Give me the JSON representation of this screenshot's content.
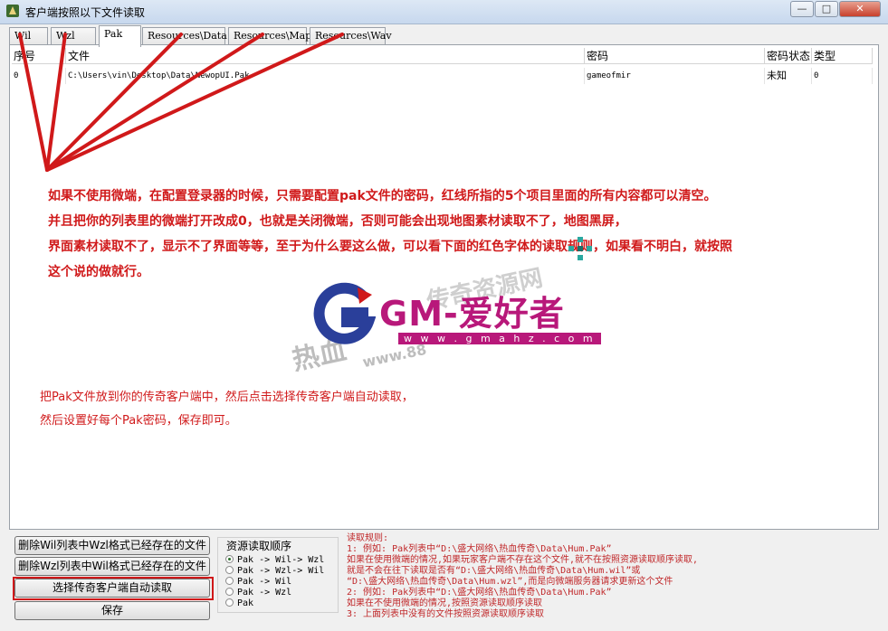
{
  "window": {
    "title": "客户端按照以下文件读取",
    "controls": {
      "minimize": "—",
      "maximize": "□",
      "close": "✕"
    }
  },
  "tabs": [
    {
      "label": "Wil"
    },
    {
      "label": "Wzl"
    },
    {
      "label": "Pak"
    },
    {
      "label": "Resources\\Data"
    },
    {
      "label": "Resources\\Map"
    },
    {
      "label": "Resources\\Wav"
    }
  ],
  "grid": {
    "columns": [
      "序号",
      "文件",
      "密码",
      "密码状态",
      "类型"
    ],
    "rows": [
      [
        "0",
        "C:\\Users\\vin\\Desktop\\Data\\NewopUI.Pak",
        "gameofmir",
        "未知",
        "0"
      ]
    ]
  },
  "notes": {
    "line1": "如果不使用微端，在配置登录器的时候，只需要配置pak文件的密码，红线所指的5个项目里面的所有内容都可以清空。",
    "line2": "并且把你的列表里的微端打开改成0，也就是关闭微端，否则可能会出现地图素材读取不了，地图黑屏，",
    "line3": "界面素材读取不了，显示不了界面等等，至于为什么要这么做，可以看下面的红色字体的读取规则，如果看不明白，就按照",
    "line4": "这个说的做就行。",
    "hint1": "把Pak文件放到你的传奇客户端中，然后点击选择传奇客户端自动读取，",
    "hint2": "然后设置好每个Pak密码，保存即可。"
  },
  "logo": {
    "letter": "G",
    "text": "GM-爱好者",
    "url": "w w w . g m a h z . c o m"
  },
  "watermark": {
    "text1": "热血",
    "text2": "传奇资源网",
    "text3": "www.88"
  },
  "buttons": {
    "delete_wil": "删除Wil列表中Wzl格式已经存在的文件",
    "delete_wzl": "删除Wzl列表中Wil格式已经存在的文件",
    "auto_read": "选择传奇客户端自动读取",
    "save": "保存"
  },
  "read_order": {
    "title": "资源读取顺序",
    "options": [
      {
        "label": "Pak -> Wil-> Wzl",
        "selected": true
      },
      {
        "label": "Pak -> Wzl-> Wil",
        "selected": false
      },
      {
        "label": "Pak -> Wil",
        "selected": false
      },
      {
        "label": "Pak -> Wzl",
        "selected": false
      },
      {
        "label": "Pak",
        "selected": false
      }
    ]
  },
  "rules": [
    "读取规则:",
    "1: 例如: Pak列表中“D:\\盛大网络\\热血传奇\\Data\\Hum.Pak”",
    "      如果在使用微端的情况,如果玩家客户端不存在这个文件,就不在按照资源读取顺序读取,",
    "      就是不会在往下读取是否有“D:\\盛大网络\\热血传奇\\Data\\Hum.wil”或",
    "   “D:\\盛大网络\\热血传奇\\Data\\Hum.wzl”,而是向微端服务器请求更新这个文件",
    "2: 例如: Pak列表中“D:\\盛大网络\\热血传奇\\Data\\Hum.Pak”",
    "      如果在不使用微端的情况,按照资源读取顺序读取",
    "3: 上面列表中没有的文件按照资源读取顺序读取"
  ],
  "colors": {
    "annotation_red": "#d0191a",
    "logo_magenta": "#b8187a",
    "logo_blue": "#2a3f9a"
  }
}
